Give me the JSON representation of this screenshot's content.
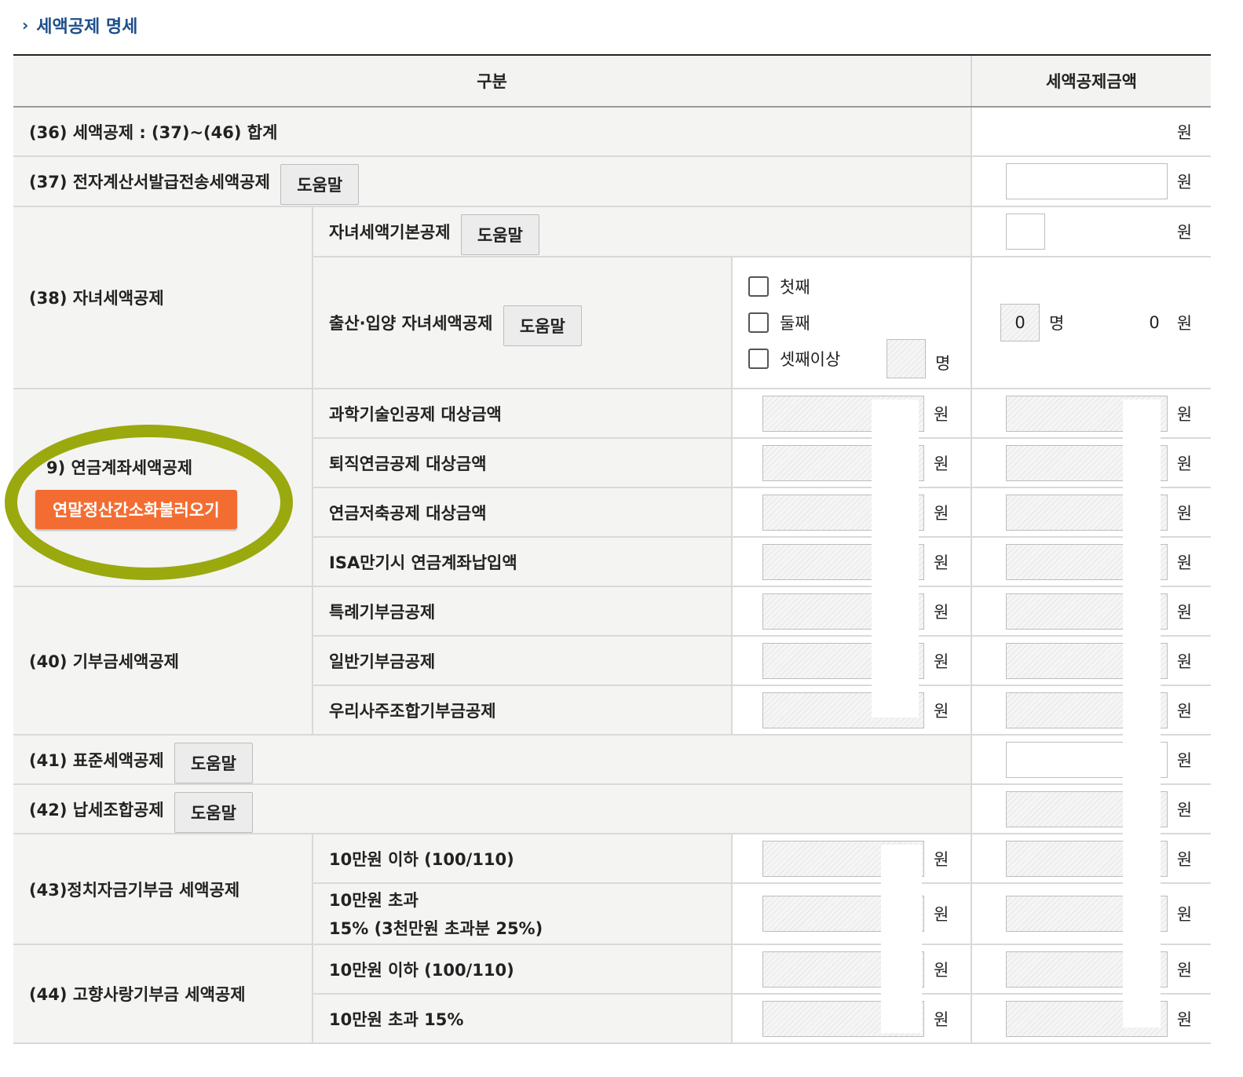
{
  "section_title": "세액공제 명세",
  "header": {
    "col1": "구분",
    "col2": "세액공제금액"
  },
  "unit_won": "원",
  "unit_person": "명",
  "help_label": "도움말",
  "rows": {
    "r36": "(36) 세액공제 : (37)~(46) 합계",
    "r37": "(37) 전자계산서발급전송세액공제",
    "r38": "(38) 자녀세액공제",
    "r38_basic": "자녀세액기본공제",
    "r38_birth": "출산·입양 자녀세액공제",
    "r38_first": "첫째",
    "r38_second": "둘째",
    "r38_third": "셋째이상",
    "r38_count": "0",
    "r38_amount": "0",
    "r39": "9) 연금계좌세액공제",
    "r39_button": "연말정산간소화불러오기",
    "r39_a": "과학기술인공제 대상금액",
    "r39_b": "퇴직연금공제 대상금액",
    "r39_c": "연금저축공제 대상금액",
    "r39_d": "ISA만기시 연금계좌납입액",
    "r40": "(40) 기부금세액공제",
    "r40_a": "특례기부금공제",
    "r40_b": "일반기부금공제",
    "r40_c": "우리사주조합기부금공제",
    "r41": "(41) 표준세액공제",
    "r42": "(42) 납세조합공제",
    "r43": "(43)정치자금기부금 세액공제",
    "r43_a": "10만원 이하 (100/110)",
    "r43_b1": "10만원 초과",
    "r43_b2": "15% (3천만원 초과분 25%)",
    "r44": "(44) 고향사랑기부금 세액공제",
    "r44_a": "10만원 이하 (100/110)",
    "r44_b": "10만원 초과 15%"
  },
  "colors": {
    "title": "#1d4f8c",
    "orange_button": "#f36d33",
    "highlight_ellipse": "#9aa90e"
  }
}
